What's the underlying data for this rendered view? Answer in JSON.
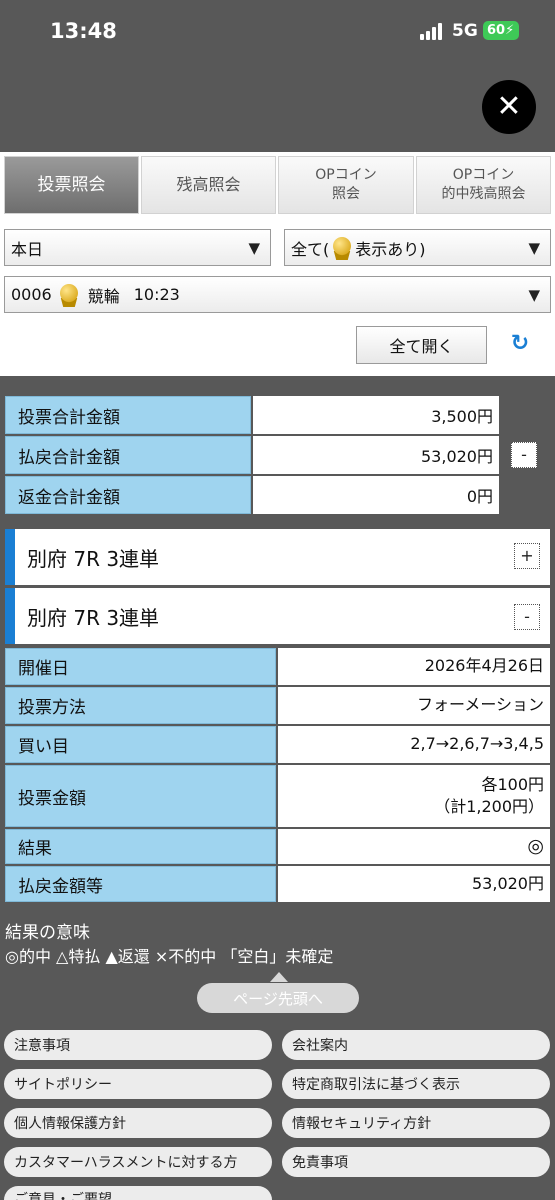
{
  "status_bar": {
    "time": "13:48",
    "network": "5G",
    "battery": "60"
  },
  "close_label": "✕",
  "tabs": [
    {
      "label": "投票照会",
      "active": true
    },
    {
      "label": "残高照会",
      "active": false
    },
    {
      "line1": "OPコイン",
      "line2": "照会",
      "active": false
    },
    {
      "line1": "OPコイン",
      "line2": "的中残高照会",
      "active": false
    }
  ],
  "filters": {
    "date_selected": "本日",
    "display_prefix": "全て(",
    "display_suffix": "表示あり)",
    "race_code": "0006",
    "race_sport": "競輪",
    "race_time": "10:23"
  },
  "open_all_label": "全て開く",
  "summary": [
    {
      "label": "投票合計金額",
      "value": "3,500円"
    },
    {
      "label": "払戻合計金額",
      "value": "53,020円"
    },
    {
      "label": "返金合計金額",
      "value": "0円"
    }
  ],
  "summary_toggle": "-",
  "races": [
    {
      "title": "別府 7R 3連単",
      "toggle": "+"
    },
    {
      "title": "別府 7R 3連単",
      "toggle": "-"
    }
  ],
  "details": [
    {
      "label": "開催日",
      "value": "2026年4月26日"
    },
    {
      "label": "投票方法",
      "value": "フォーメーション"
    },
    {
      "label": "買い目",
      "value": "2,7→2,6,7→3,4,5"
    },
    {
      "label": "投票金額",
      "value": "各100円",
      "value2": "（計1,200円）"
    },
    {
      "label": "結果",
      "value": "◎"
    },
    {
      "label": "払戻金額等",
      "value": "53,020円"
    }
  ],
  "legend": {
    "title": "結果の意味",
    "text": "◎的中 △特払 ▲返還 ×不的中 「空白」未確定"
  },
  "page_top_label": "ページ先頭へ",
  "footer_links": [
    "注意事項",
    "会社案内",
    "サイトポリシー",
    "特定商取引法に基づく表示",
    "個人情報保護方針",
    "情報セキュリティ方針",
    "カスタマーハラスメントに対する方",
    "免責事項",
    "ご意見・ご要望"
  ],
  "colors": {
    "accent": "#1a7fd4",
    "label_bg": "#9fd4ef",
    "page_bg": "#585858",
    "battery": "#3ec957"
  }
}
